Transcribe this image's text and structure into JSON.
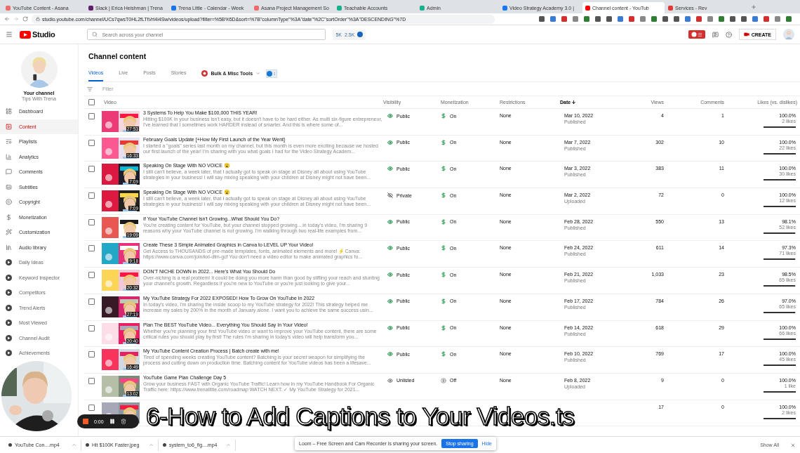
{
  "browser": {
    "tabs": [
      {
        "title": "YouTube Content - Asana",
        "color": "#f06a6a",
        "selected": false
      },
      {
        "title": "Slack | Erica Heishman | Trena",
        "color": "#611f69",
        "selected": false
      },
      {
        "title": "Trena Little - Calendar - Week",
        "color": "#1a73e8",
        "selected": false
      },
      {
        "title": "Asana Project Management So",
        "color": "#f06a6a",
        "selected": false
      },
      {
        "title": "Teachable Accounts",
        "color": "#13b18c",
        "selected": false
      },
      {
        "title": "Admin",
        "color": "#13b18c",
        "selected": false
      },
      {
        "title": "Video Strategy Academy 3.0 |",
        "color": "#1877f2",
        "selected": false
      },
      {
        "title": "Channel content - YouTub",
        "color": "#ff0000",
        "selected": true
      },
      {
        "title": "Services - Rev",
        "color": "#e53935",
        "selected": false
      }
    ],
    "url": "studio.youtube.com/channel/UCs7qwsT0HL2fLTtVrt4i4Sw/videos/upload?filter=%5B%5D&sort=%7B\"columnType\"%3A\"date\"%2C\"sortOrder\"%3A\"DESCENDING\"%7D"
  },
  "header": {
    "logo": "Studio",
    "search_placeholder": "Search across your channel",
    "stats": [
      "5K",
      "2.5K"
    ],
    "create": "CREATE"
  },
  "channel": {
    "title": "Your channel",
    "name": "Tips With Trena"
  },
  "sidebar": {
    "items": [
      {
        "label": "Dashboard",
        "kind": "studio",
        "selected": false
      },
      {
        "label": "Content",
        "kind": "studio",
        "selected": true
      },
      {
        "label": "Playlists",
        "kind": "studio",
        "selected": false
      },
      {
        "label": "Analytics",
        "kind": "studio",
        "selected": false
      },
      {
        "label": "Comments",
        "kind": "studio",
        "selected": false
      },
      {
        "label": "Subtitles",
        "kind": "studio",
        "selected": false
      },
      {
        "label": "Copyright",
        "kind": "studio",
        "selected": false
      },
      {
        "label": "Monetization",
        "kind": "studio",
        "selected": false
      },
      {
        "label": "Customization",
        "kind": "studio",
        "selected": false
      },
      {
        "label": "Audio library",
        "kind": "studio",
        "selected": false
      },
      {
        "label": "Daily Ideas",
        "kind": "extension",
        "selected": false
      },
      {
        "label": "Keyword Inspector",
        "kind": "extension",
        "selected": false
      },
      {
        "label": "Competitors",
        "kind": "extension",
        "selected": false
      },
      {
        "label": "Trend Alerts",
        "kind": "extension",
        "selected": false
      },
      {
        "label": "Most Viewed",
        "kind": "extension",
        "selected": false
      },
      {
        "label": "Channel Audit",
        "kind": "extension",
        "selected": false
      },
      {
        "label": "Achievements",
        "kind": "extension",
        "selected": false
      }
    ]
  },
  "page": {
    "title": "Channel content",
    "tabs": [
      {
        "label": "Videos",
        "selected": true
      },
      {
        "label": "Live",
        "selected": false
      },
      {
        "label": "Posts",
        "selected": false
      },
      {
        "label": "Stories",
        "selected": false
      }
    ],
    "tools": "Bulk & Misc Tools",
    "filter_placeholder": "Filter"
  },
  "table": {
    "select_all_checked": false,
    "columns": [
      {
        "label": "Video",
        "sorted": false
      },
      {
        "label": "Visibility",
        "sorted": false
      },
      {
        "label": "Monetization",
        "sorted": false
      },
      {
        "label": "Restrictions",
        "sorted": false
      },
      {
        "label": "Date",
        "sorted": true
      },
      {
        "label": "Views",
        "sorted": false
      },
      {
        "label": "Comments",
        "sorted": false
      },
      {
        "label": "Likes (vs. dislikes)",
        "sorted": false
      }
    ],
    "rows": [
      {
        "checked": false,
        "duration": "27:53",
        "title": "3 Systems To Help You Make $100,000 THIS YEAR!",
        "description": "Hitting $100K in your business isn't easy, but it doesn't have to be hard either. As multi six-figure entrepreneur, I've learned that I sometimes work HARDER instead of smarter. And this is where some of...",
        "visibility": {
          "label": "Public",
          "kind": "public"
        },
        "monetization": "On",
        "monetized": true,
        "restrictions": "None",
        "date": "Mar 10, 2022",
        "status": "Published",
        "views": "4",
        "comments": "1",
        "likes_pct": "100.0%",
        "likes": "2 likes",
        "level": 1
      },
      {
        "checked": false,
        "duration": "16:33",
        "title": "February Goals Update [+How My First Launch of the Year Went]",
        "description": "I started a \"goals\" series last month on my channel, but this month is even more exciting because we hosted our first launch of the year! I'm sharing with you what goals I had for the Video Strategy Academ...",
        "visibility": {
          "label": "Public",
          "kind": "public"
        },
        "monetization": "On",
        "monetized": true,
        "restrictions": "None",
        "date": "Mar 7, 2022",
        "status": "Published",
        "views": "302",
        "comments": "10",
        "likes_pct": "100.0%",
        "likes": "22 likes",
        "level": 1
      },
      {
        "checked": false,
        "duration": "7:09",
        "title": "Speaking On Stage With NO VOICE 😮",
        "description": "I still can't believe, a week later, that I actually got to speak on stage at Disney all about using YouTube strategies in your business! I will say mixing speaking with your children at Disney might not have been...",
        "visibility": {
          "label": "Public",
          "kind": "public"
        },
        "monetization": "On",
        "monetized": true,
        "restrictions": "None",
        "date": "Mar 3, 2022",
        "status": "Published",
        "views": "383",
        "comments": "11",
        "likes_pct": "100.0%",
        "likes": "30 likes",
        "level": 1
      },
      {
        "checked": false,
        "duration": "7:09",
        "title": "Speaking On Stage With NO VOICE 😮",
        "description": "I still can't believe, a week later, that I actually got to speak on stage at Disney all about using YouTube strategies in your business! I will say mixing speaking with your children at Disney might not have been...",
        "visibility": {
          "label": "Private",
          "kind": "private"
        },
        "monetization": "On",
        "monetized": true,
        "restrictions": "None",
        "date": "Mar 2, 2022",
        "status": "Uploaded",
        "views": "72",
        "comments": "0",
        "likes_pct": "100.0%",
        "likes": "12 likes",
        "level": 1
      },
      {
        "checked": false,
        "duration": "19:09",
        "title": "If Your YouTube Channel Isn't Growing...What Should You Do?",
        "description": "You're creating content for YouTube, but your channel stopped growing... in today's video, I'm sharing 9 reasons why your YouTube channel is not growing. I'm walking through two real-life examples from...",
        "visibility": {
          "label": "Public",
          "kind": "public"
        },
        "monetization": "On",
        "monetized": true,
        "restrictions": "None",
        "date": "Feb 28, 2022",
        "status": "Published",
        "views": "550",
        "comments": "13",
        "likes_pct": "98.1%",
        "likes": "52 likes",
        "level": 0.981
      },
      {
        "checked": false,
        "duration": "9:18",
        "title": "Create These 3 Simple Animated Graphics in Canva to LEVEL UP Your Video!",
        "description": "Get Access to THOUSANDS of pre-made templates, fonts, animated elements and more! ⚡Canva: https://www.canva.com/join/kxl-dtm-gcf You don't need a video editor to make animated graphics fo...",
        "visibility": {
          "label": "Public",
          "kind": "public"
        },
        "monetization": "On",
        "monetized": true,
        "restrictions": "None",
        "date": "Feb 24, 2022",
        "status": "Published",
        "views": "611",
        "comments": "14",
        "likes_pct": "97.3%",
        "likes": "71 likes",
        "level": 0.973
      },
      {
        "checked": false,
        "duration": "20:32",
        "title": "DON'T NICHE DOWN in 2022... Here's What You Should Do",
        "description": "Over-niching is a real problem! It could be doing you more harm than good by stifling your reach and stunting your channel's growth. Regardless if you're new to YouTube or you're just looking to give your...",
        "visibility": {
          "label": "Public",
          "kind": "public"
        },
        "monetization": "On",
        "monetized": true,
        "restrictions": "None",
        "date": "Feb 21, 2022",
        "status": "Published",
        "views": "1,033",
        "comments": "23",
        "likes_pct": "98.5%",
        "likes": "65 likes",
        "level": 0.985
      },
      {
        "checked": false,
        "duration": "27:19",
        "title": "My YouTube Strategy For 2022 EXPOSED! How To Grow On YouTube In 2022",
        "description": "In today's video, I'm sharing the inside scoop to my YouTube strategy for 2022! This strategy helped me increase my sales by 200% in the month of January alone. I want you to achieve the same success usin...",
        "visibility": {
          "label": "Public",
          "kind": "public"
        },
        "monetization": "On",
        "monetized": true,
        "restrictions": "None",
        "date": "Feb 17, 2022",
        "status": "Published",
        "views": "784",
        "comments": "26",
        "likes_pct": "97.0%",
        "likes": "65 likes",
        "level": 0.97
      },
      {
        "checked": false,
        "duration": "20:40",
        "title": "Plan The BEST YouTube Video... Everything You Should Say In Your Video!",
        "description": "Whether you're planning your first YouTube video or want to improve your YouTube content, there are some critical rules you should play by first! The rules I'm sharing in today's video will help transform you...",
        "visibility": {
          "label": "Public",
          "kind": "public"
        },
        "monetization": "On",
        "monetized": true,
        "restrictions": "None",
        "date": "Feb 14, 2022",
        "status": "Published",
        "views": "618",
        "comments": "29",
        "likes_pct": "100.0%",
        "likes": "66 likes",
        "level": 1
      },
      {
        "checked": false,
        "duration": "16:49",
        "title": "My YouTube Content Creation Process | Batch create with me!",
        "description": "Tired of spending weeks creating YouTube content? Batching is your secret weapon for simplifying the process and cutting down on production time. Batching content for YouTube videos has been a lifesave...",
        "visibility": {
          "label": "Public",
          "kind": "public"
        },
        "monetization": "On",
        "monetized": true,
        "restrictions": "None",
        "date": "Feb 10, 2022",
        "status": "Published",
        "views": "769",
        "comments": "17",
        "likes_pct": "100.0%",
        "likes": "45 likes",
        "level": 1
      },
      {
        "checked": false,
        "duration": "13:02",
        "title": "YouTube Game Plan Challenge Day 5",
        "description": "Grow your business FAST with Organic YouTube Traffic! Learn how in my YouTube Handbook For Organic Traffic here: https://www.trenalittle.com/roadmap WATCH NEXT: ✓ My YouTube Strategy for 2021...",
        "visibility": {
          "label": "Unlisted",
          "kind": "unlisted"
        },
        "monetization": "Off",
        "monetized": false,
        "restrictions": "None",
        "date": "Feb 8, 2022",
        "status": "Uploaded",
        "views": "9",
        "comments": "0",
        "likes_pct": "100.0%",
        "likes": "1 like",
        "level": 1
      },
      {
        "checked": false,
        "views": "17",
        "comments": "0",
        "likes_pct": "100.0%",
        "likes": "2 likes",
        "level": 1
      }
    ]
  },
  "recorder": {
    "time": "0:00"
  },
  "caption_overlay": "6-How to Add Captions to Your Videos.ts",
  "share_banner": {
    "message": "Loom – Free Screen and Cam Recorder is sharing your screen.",
    "stop": "Stop sharing",
    "hide": "Hide"
  },
  "downloads": {
    "items": [
      "YouTube Con....mp4",
      "Hit $100K Faster.jpeg",
      "system_to6_fig....mp4"
    ],
    "show_all": "Show All"
  }
}
